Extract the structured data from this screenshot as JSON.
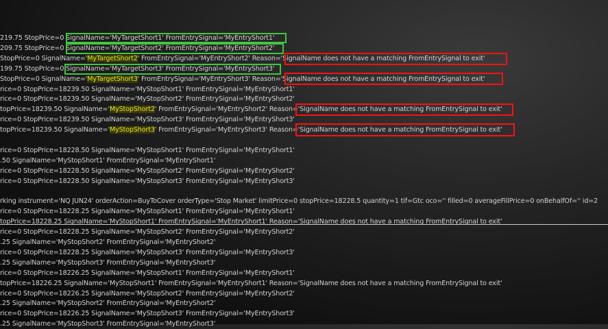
{
  "log_lines": [
    {
      "segments": [
        {
          "text": "219.75 StopPrice=0 SignalName='MyTargetShort1' FromEntrySignal='MyEntryShort1'",
          "hl": false
        }
      ]
    },
    {
      "segments": [
        {
          "text": "209.75 StopPrice=0 SignalName='MyTargetShort2' FromEntrySignal='MyEntryShort2'",
          "hl": false
        }
      ]
    },
    {
      "segments": [
        {
          "text": "StopPrice=0 SignalName='",
          "hl": false
        },
        {
          "text": "MyTargetShort2",
          "hl": true
        },
        {
          "text": "' FromEntrySignal='MyEntryShort2' Reason='SignalName does not have a matching FromEntrySignal to exit'",
          "hl": false
        }
      ]
    },
    {
      "segments": [
        {
          "text": "199.75 StopPrice=0 SignalName='MyTargetShort3' FromEntrySignal='MyEntryShort3'",
          "hl": false
        }
      ]
    },
    {
      "segments": [
        {
          "text": "StopPrice=0 SignalName='",
          "hl": false
        },
        {
          "text": "MyTargetShort3",
          "hl": true
        },
        {
          "text": "' FromEntrySignal='MyEntryShort3' Reason='SignalName does not have a matching FromEntrySignal to exit'",
          "hl": false
        }
      ]
    },
    {
      "segments": [
        {
          "text": "rice=0 StopPrice=18239.50 SignalName='MyStopShort1' FromEntrySignal='MyEntryShort1'",
          "hl": false
        }
      ]
    },
    {
      "segments": [
        {
          "text": "rice=0 StopPrice=18239.50 SignalName='MyStopShort2' FromEntrySignal='MyEntryShort2'",
          "hl": false
        }
      ]
    },
    {
      "segments": [
        {
          "text": "topPrice=18239.50 SignalName='",
          "hl": false
        },
        {
          "text": "MyStopShort2",
          "hl": true
        },
        {
          "text": "' FromEntrySignal='MyEntryShort2' Reason='SignalName does not have a matching FromEntrySignal to exit'",
          "hl": false
        }
      ]
    },
    {
      "segments": [
        {
          "text": "rice=0 StopPrice=18239.50 SignalName='MyStopShort3' FromEntrySignal='MyEntryShort3'",
          "hl": false
        }
      ]
    },
    {
      "segments": [
        {
          "text": "topPrice=18239.50 SignalName='",
          "hl": false
        },
        {
          "text": "MyStopShort3",
          "hl": true
        },
        {
          "text": "' FromEntrySignal='MyEntryShort3' Reason='SignalName does not have a matching FromEntrySignal to exit'",
          "hl": false
        }
      ]
    },
    {
      "segments": [
        {
          "text": "",
          "hl": false
        }
      ]
    },
    {
      "segments": [
        {
          "text": "rice=0 StopPrice=18228.50 SignalName='MyStopShort1' FromEntrySignal='MyEntryShort1'",
          "hl": false
        }
      ]
    },
    {
      "segments": [
        {
          "text": ".50 SignalName='MyStopShort1' FromEntrySignal='MyEntryShort1'",
          "hl": false
        }
      ]
    },
    {
      "segments": [
        {
          "text": "rice=0 StopPrice=18228.50 SignalName='MyStopShort2' FromEntrySignal='MyEntryShort2'",
          "hl": false
        }
      ]
    },
    {
      "segments": [
        {
          "text": "rice=0 StopPrice=18228.50 SignalName='MyStopShort3' FromEntrySignal='MyEntryShort3'",
          "hl": false
        }
      ]
    },
    {
      "segments": [
        {
          "text": "",
          "hl": false
        }
      ]
    },
    {
      "segments": [
        {
          "text": "rking instrument='NQ JUN24' orderAction=BuyToCover orderType='Stop Market' limitPrice=0 stopPrice=18228.5 quantity=1 tif=Gtc oco='' filled=0 averageFillPrice=0 onBehalfOf='' id=2",
          "hl": false
        }
      ]
    },
    {
      "segments": [
        {
          "text": "rice=0 StopPrice=18228.25 SignalName='MyStopShort1' FromEntrySignal='MyEntryShort1'",
          "hl": false
        }
      ]
    },
    {
      "segments": [
        {
          "text": "topPrice=18228.25 SignalName='MyStopShort1' FromEntrySignal='MyEntryShort1' Reason='SignalName does not have a matching FromEntrySignal to exit'",
          "hl": false
        }
      ]
    },
    {
      "segments": [
        {
          "text": "rice=0 StopPrice=18228.25 SignalName='MyStopShort2' FromEntrySignal='MyEntryShort2'",
          "hl": false
        }
      ]
    },
    {
      "segments": [
        {
          "text": ".25 SignalName='MyStopShort2' FromEntrySignal='MyEntryShort2'",
          "hl": false
        }
      ]
    },
    {
      "segments": [
        {
          "text": "rice=0 StopPrice=18228.25 SignalName='MyStopShort3' FromEntrySignal='MyEntryShort3'",
          "hl": false
        }
      ]
    },
    {
      "segments": [
        {
          "text": ".25 SignalName='MyStopShort3' FromEntrySignal='MyEntryShort3'",
          "hl": false
        }
      ]
    },
    {
      "segments": [
        {
          "text": "rice=0 StopPrice=18226.25 SignalName='MyStopShort1' FromEntrySignal='MyEntryShort1'",
          "hl": false
        }
      ]
    },
    {
      "segments": [
        {
          "text": "topPrice=18226.25 SignalName='MyStopShort1' FromEntrySignal='MyEntryShort1' Reason='SignalName does not have a matching FromEntrySignal to exit'",
          "hl": false
        }
      ]
    },
    {
      "segments": [
        {
          "text": "rice=0 StopPrice=18226.25 SignalName='MyStopShort2' FromEntrySignal='MyEntryShort2'",
          "hl": false
        }
      ]
    },
    {
      "segments": [
        {
          "text": ".25 SignalName='MyStopShort2' FromEntrySignal='MyEntryShort2'",
          "hl": false
        }
      ]
    },
    {
      "segments": [
        {
          "text": "rice=0 StopPrice=18226.25 SignalName='MyStopShort3' FromEntrySignal='MyEntryShort3'",
          "hl": false
        }
      ]
    },
    {
      "segments": [
        {
          "text": ".25 SignalName='MyStopShort3' FromEntrySignal='MyEntryShort3'",
          "hl": false
        }
      ]
    }
  ],
  "colors": {
    "text": "#d2d2d2",
    "highlight_text": "#e8e800",
    "green_box": "#3ec93e",
    "red_box": "#ff1010"
  }
}
